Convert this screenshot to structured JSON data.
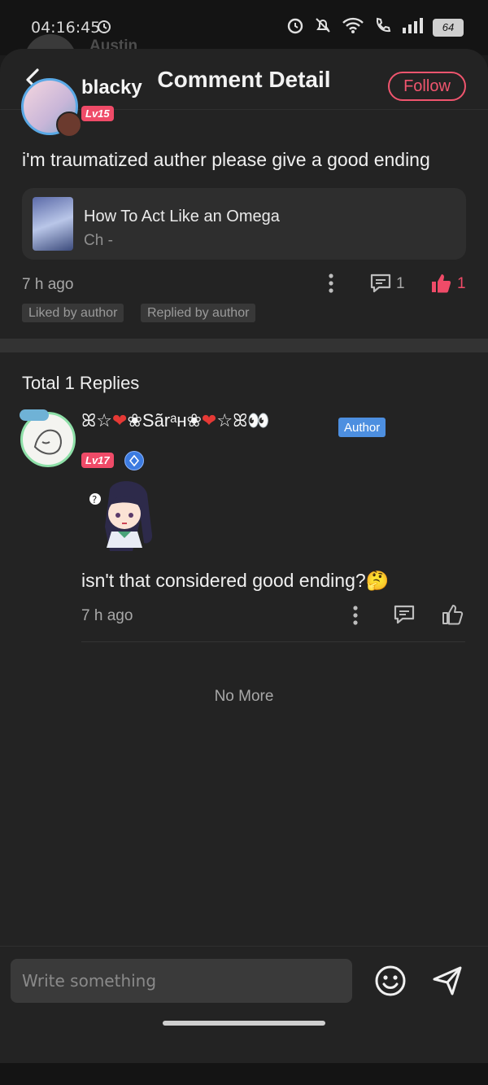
{
  "status": {
    "time": "04:16:45",
    "battery": "64"
  },
  "background": {
    "peek_name": "Austin"
  },
  "header": {
    "title": "Comment Detail"
  },
  "comment": {
    "user": "blacky",
    "level": "Lv15",
    "follow_label": "Follow",
    "text": "i'm traumatized auther please give a good ending",
    "book": {
      "title": "How To Act Like an Omega",
      "chapter": "Ch -"
    },
    "time": "7 h ago",
    "reply_count": "1",
    "like_count": "1",
    "tags": [
      "Liked by author",
      "Replied by author"
    ]
  },
  "replies": {
    "total_label": "Total 1 Replies",
    "items": [
      {
        "user_left": "ꕤ☆",
        "user_heart1": "❤",
        "user_mid": "❀Sãrᵃʜ❀",
        "user_heart2": "❤",
        "user_right": "☆ꕤ👀",
        "author_tag": "Author",
        "level": "Lv17",
        "text": "isn't that considered good ending?🤔",
        "time": "7 h ago"
      }
    ],
    "end_label": "No More"
  },
  "composer": {
    "placeholder": "Write something"
  },
  "colors": {
    "accent": "#ef4b68",
    "author_tag": "#4d8fe0"
  }
}
